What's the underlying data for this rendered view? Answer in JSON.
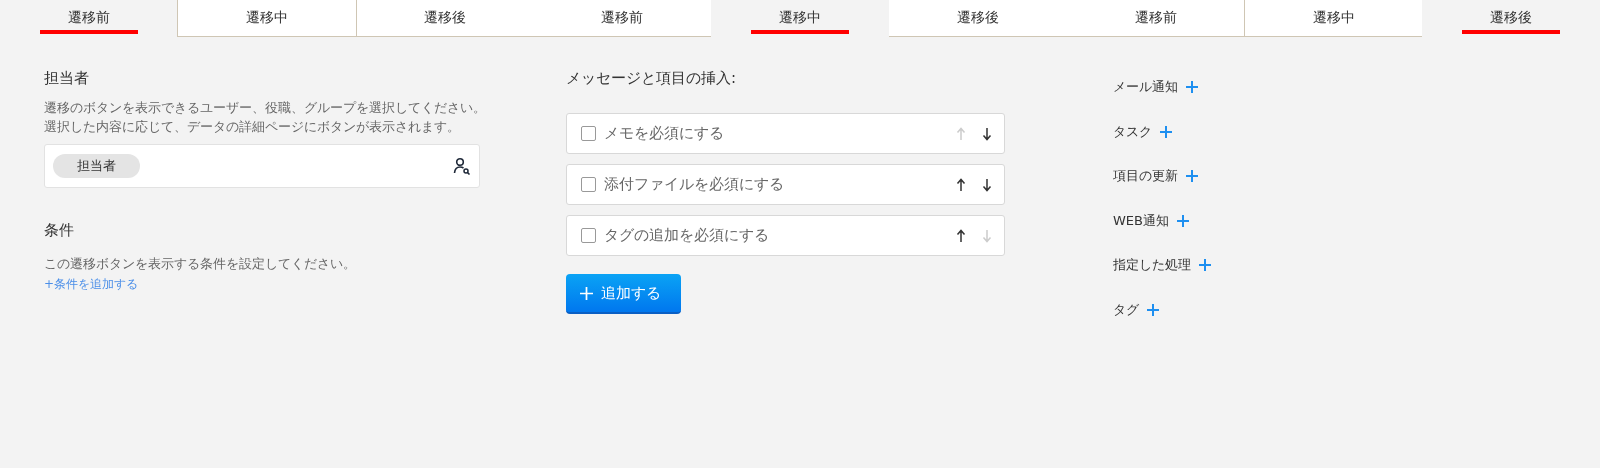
{
  "tabs": [
    {
      "label": "遷移前",
      "selected": true
    },
    {
      "label": "遷移中",
      "selected": false
    },
    {
      "label": "遷移後",
      "selected": false
    },
    {
      "label": "遷移前",
      "selected": false
    },
    {
      "label": "遷移中",
      "selected": true
    },
    {
      "label": "遷移後",
      "selected": false
    },
    {
      "label": "遷移前",
      "selected": false
    },
    {
      "label": "遷移中",
      "selected": false
    },
    {
      "label": "遷移後",
      "selected": true
    }
  ],
  "assignee": {
    "title": "担当者",
    "description": "遷移のボタンを表示できるユーザー、役職、グループを選択してください。選択した内容に応じて、データの詳細ページにボタンが表示されます。",
    "chips": [
      "担当者"
    ]
  },
  "conditions": {
    "title": "条件",
    "description": "この遷移ボタンを表示する条件を設定してください。",
    "add_link": "+条件を追加する"
  },
  "insert": {
    "title": "メッセージと項目の挿入:",
    "options": [
      {
        "label": "メモを必須にする",
        "checked": false,
        "up_disabled": true,
        "down_disabled": false
      },
      {
        "label": "添付ファイルを必須にする",
        "checked": false,
        "up_disabled": false,
        "down_disabled": false
      },
      {
        "label": "タグの追加を必須にする",
        "checked": false,
        "up_disabled": false,
        "down_disabled": true
      }
    ],
    "add_button": "追加する"
  },
  "actions": [
    "メール通知",
    "タスク",
    "項目の更新",
    "WEB通知",
    "指定した処理",
    "タグ"
  ]
}
